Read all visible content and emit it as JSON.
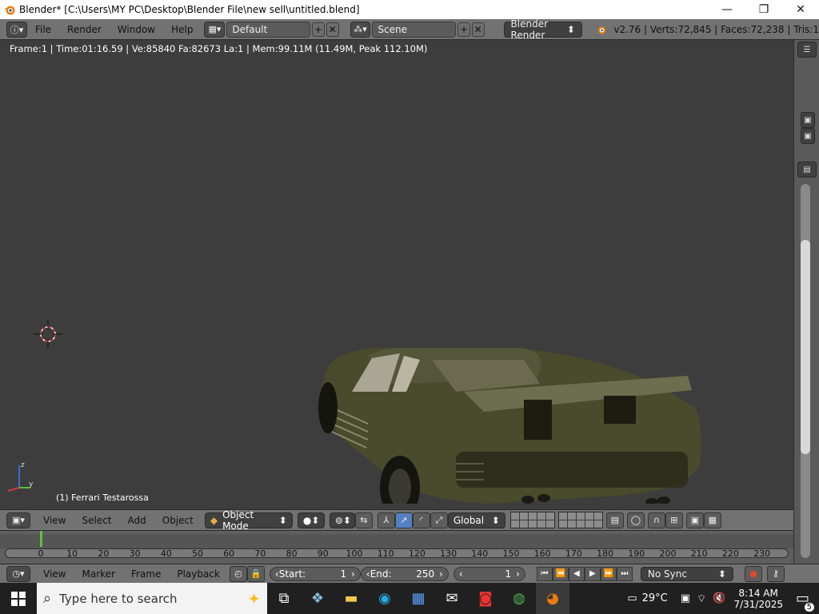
{
  "window": {
    "title": "Blender* [C:\\Users\\MY PC\\Desktop\\Blender File\\new sell\\untitled.blend]",
    "minimize_glyph": "—",
    "maximize_glyph": "❐",
    "close_glyph": "✕"
  },
  "info_header": {
    "menus": [
      "File",
      "Render",
      "Window",
      "Help"
    ],
    "layout": "Default",
    "scene": "Scene",
    "engine": "Blender Render",
    "stats": "v2.76 | Verts:72,845 | Faces:72,238 | Tris:1"
  },
  "viewport": {
    "info_text": "Frame:1 | Time:01:16.59 | Ve:85840 Fa:82673 La:1 | Mem:99.11M (11.49M, Peak 112.10M)",
    "object_label": "(1) Ferrari Testarossa",
    "axis_z": "z",
    "axis_y": "y",
    "car_color": "#4d4d2e"
  },
  "view_header": {
    "menus": [
      "View",
      "Select",
      "Add",
      "Object"
    ],
    "mode": "Object Mode",
    "orientation": "Global"
  },
  "timeline": {
    "ticks": [
      "0",
      "10",
      "20",
      "30",
      "40",
      "50",
      "60",
      "70",
      "80",
      "90",
      "100",
      "110",
      "120",
      "130",
      "140",
      "150",
      "160",
      "170",
      "180",
      "190",
      "200",
      "210",
      "220",
      "230"
    ],
    "current_frame_marker": 1
  },
  "timeline_header": {
    "menus": [
      "View",
      "Marker",
      "Frame",
      "Playback"
    ],
    "start_label": "Start:",
    "start_value": "1",
    "end_label": "End:",
    "end_value": "250",
    "current_frame": "1",
    "sync": "No Sync"
  },
  "taskbar": {
    "search_placeholder": "Type here to search",
    "weather": "29°C",
    "time": "8:14 AM",
    "date": "7/31/2025",
    "notification_count": "5"
  },
  "colors": {
    "accent_blue": "#5680c2",
    "frame_marker": "#60c040",
    "header_gray": "#727272",
    "viewport_bg": "#3d3d3d"
  }
}
